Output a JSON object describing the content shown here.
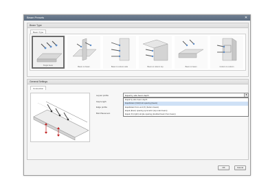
{
  "dialog": {
    "title": "Beam Presets",
    "close_symbol": "✕"
  },
  "type_group": {
    "header": "Beam Type",
    "tab": "Beam Type",
    "options": [
      {
        "caption": "Single beam",
        "icon": "single-beam-icon"
      },
      {
        "caption": "Beam on beam",
        "icon": "beam-on-beam-icon"
      },
      {
        "caption": "Beam to column side",
        "icon": "beam-to-column-side-icon"
      },
      {
        "caption": "Beam to column top",
        "icon": "beam-to-column-top-icon"
      },
      {
        "caption": "Beam to beam",
        "icon": "beam-to-beam-icon"
      },
      {
        "caption": "Column to column",
        "icon": "column-to-column-icon"
      }
    ]
  },
  "settings_group": {
    "header": "General Settings",
    "tab": "Connection",
    "fields": {
      "layout_label": "Layout profile",
      "layout_value": "Equal by side beam depth",
      "spacing_label": "Gap length",
      "edge_label": "Edge profile",
      "offset_label": "Bolt Placement"
    },
    "dropdown_options": [
      "Equal by side beam depth",
      "Equidistant (Odd) bolt spacing (beam)",
      "Equidistant from end (X) (bottom beam)",
      "Equal (Even) spacing symmetric (top-main beam)",
      "Equal (X) (right) simple spacing (doubled beam from beam)"
    ]
  },
  "buttons": {
    "ok": "OK",
    "cancel": "Cancel"
  }
}
